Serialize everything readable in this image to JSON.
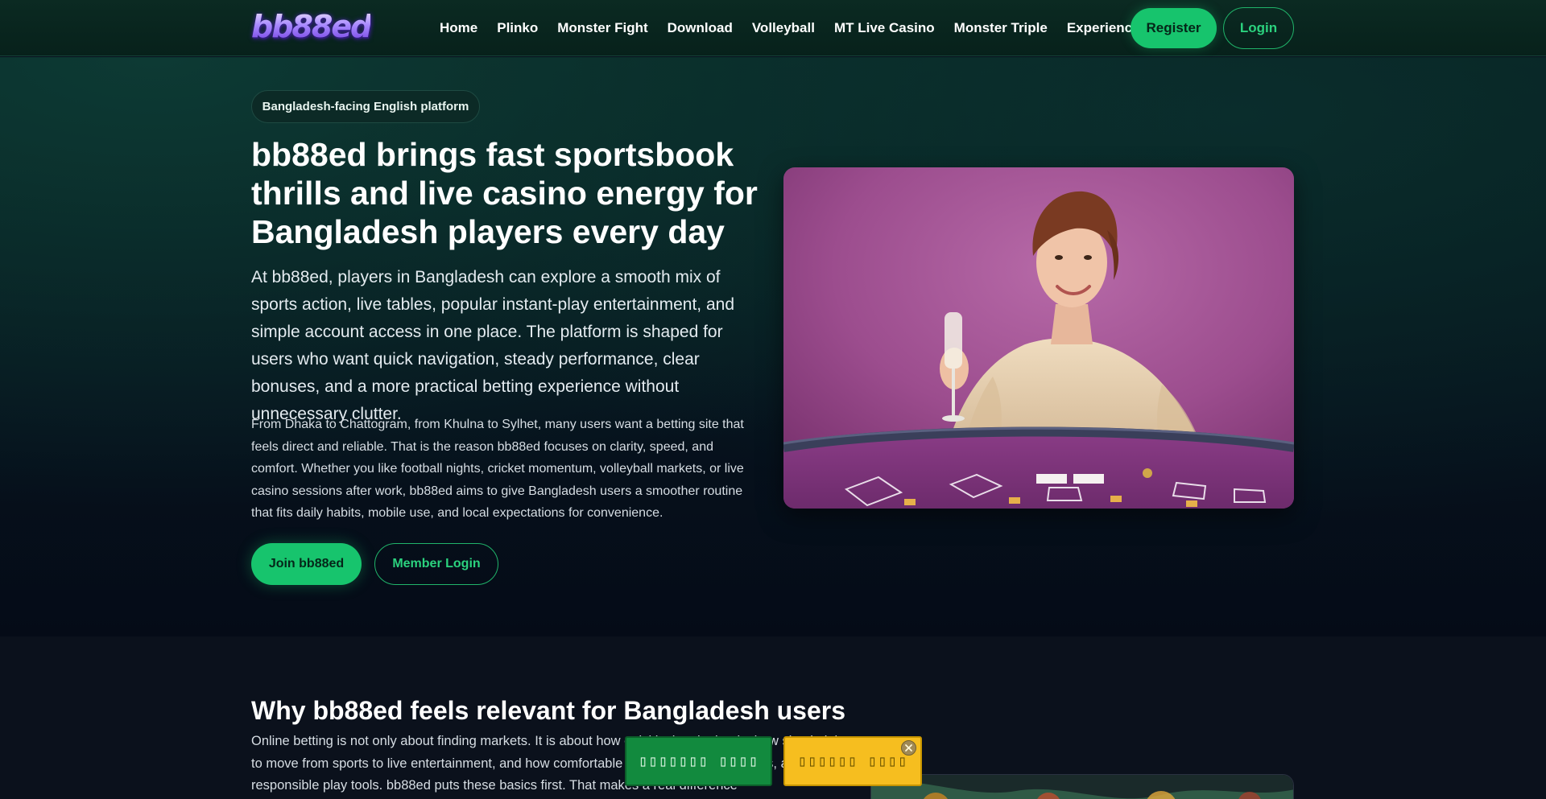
{
  "header": {
    "logo_text": "bb88ed",
    "nav": [
      {
        "label": "Home"
      },
      {
        "label": "Plinko"
      },
      {
        "label": "Monster Fight"
      },
      {
        "label": "Download"
      },
      {
        "label": "Volleyball"
      },
      {
        "label": "MT Live Casino"
      },
      {
        "label": "Monster Triple"
      },
      {
        "label": "Experiences"
      }
    ],
    "register_label": "Register",
    "login_label": "Login"
  },
  "hero": {
    "badge": "Bangladesh-facing English platform",
    "title": "bb88ed brings fast sportsbook thrills and live casino energy for Bangladesh players every day",
    "lead": "At bb88ed, players in Bangladesh can explore a smooth mix of sports action, live tables, popular instant-play entertainment, and simple account access in one place. The platform is shaped for users who want quick navigation, steady performance, clear bonuses, and a more practical betting experience without unnecessary clutter.",
    "body": "From Dhaka to Chattogram, from Khulna to Sylhet, many users want a betting site that feels direct and reliable. That is the reason bb88ed focuses on clarity, speed, and comfort. Whether you like football nights, cricket momentum, volleyball markets, or live casino sessions after work, bb88ed aims to give Bangladesh users a smoother routine that fits daily habits, mobile use, and local expectations for convenience.",
    "join_label": "Join bb88ed",
    "member_login_label": "Member Login"
  },
  "section2": {
    "title": "Why bb88ed feels relevant for Bangladesh users",
    "body": "Online betting is not only about finding markets. It is about how quickly the site loads, how simple it is to move from sports to live entertainment, and how comfortable the instant account steps, and responsible play tools. bb88ed puts these basics first. That makes a real difference"
  },
  "floating": {
    "green_label": "▯▯▯▯▯▯▯ ▯▯▯▯",
    "yellow_label": "▯▯▯▯▯▯ ▯▯▯▯"
  },
  "colors": {
    "accent_green": "#17c46d",
    "header_bg": "#07211b",
    "promo_yellow": "#f6be1f",
    "promo_green": "#128a3e"
  }
}
